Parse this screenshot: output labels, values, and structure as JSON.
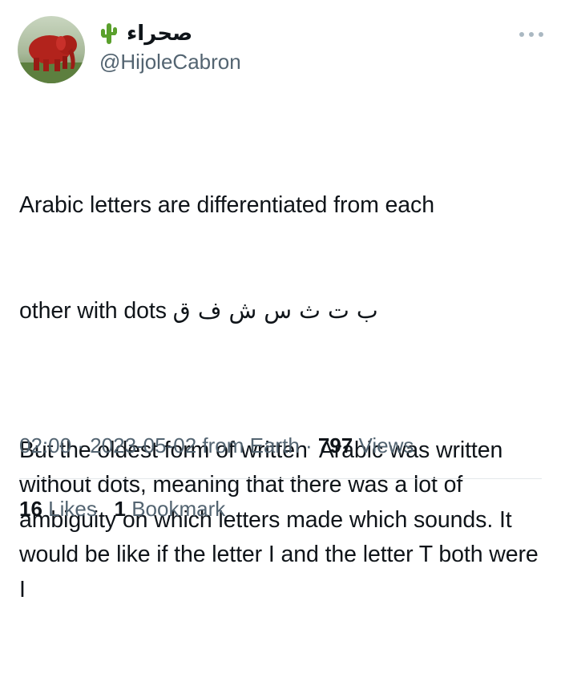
{
  "author": {
    "display_name": "صحراء",
    "handle": "@HijoleCabron",
    "name_emoji": "cactus-icon"
  },
  "tweet": {
    "line1": "Arabic letters are differentiated from each",
    "line2_prefix": "other with dots ",
    "line2_arabic": "ب ت ث س ش ف ق",
    "paragraph2": "But the oldest form of written  Arabic was written without dots, meaning that there was a lot of ambiguity on which letters made which sounds. It would be like if the letter I and the letter T both were I"
  },
  "meta": {
    "time": "02:00",
    "separator": " · ",
    "date": "2023-05-02",
    "source": " from Earth",
    "separator2": " · ",
    "views_count": "797",
    "views_label": " Views"
  },
  "stats": {
    "likes_count": "16",
    "likes_label": " Likes",
    "bookmarks_count": "1",
    "bookmarks_label": "Bookmark"
  },
  "colors": {
    "text_primary": "#0f1419",
    "text_secondary": "#536471",
    "divider": "#e3e7ea"
  }
}
